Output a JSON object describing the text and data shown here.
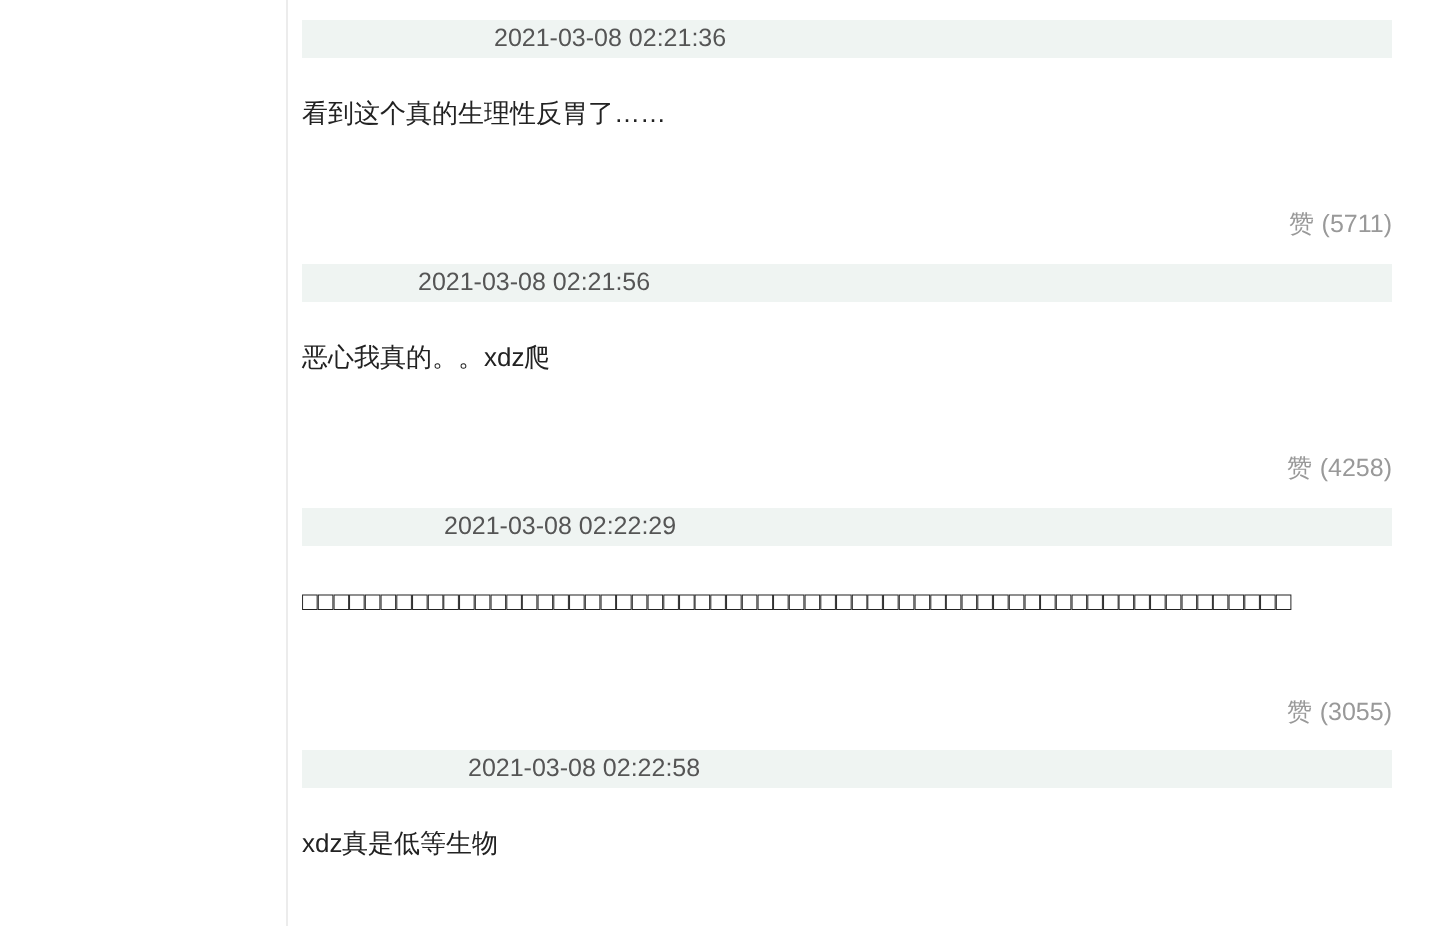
{
  "comments": [
    {
      "time": "2021-03-08 02:21:36",
      "text": "看到这个真的生理性反胃了……",
      "likes": "赞 (5711)"
    },
    {
      "time": "2021-03-08 02:21:56",
      "text": "恶心我真的。。xdz爬",
      "likes": "赞 (4258)"
    },
    {
      "time": "2021-03-08 02:22:29",
      "text": "□□□□□□□□□□□□□□□□□□□□□□□□□□□□□□□□□□□□□□□□□□□□□□□□□□□□□□□□□□□□□□□",
      "likes": "赞 (3055)"
    },
    {
      "time": "2021-03-08 02:22:58",
      "text": "xdz真是低等生物"
    }
  ]
}
